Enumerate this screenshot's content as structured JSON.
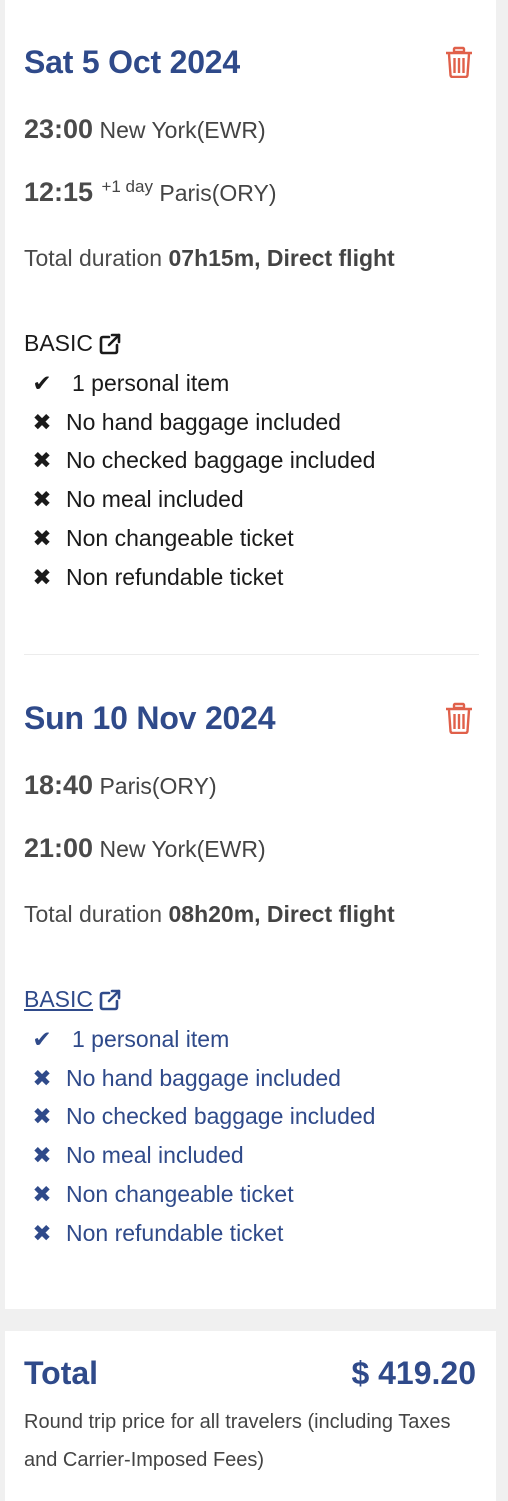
{
  "colors": {
    "accent": "#2f4a8a",
    "trash": "#e0604a",
    "text": "#4a4a4a",
    "background": "#f0f0f0",
    "card": "#ffffff"
  },
  "segments": [
    {
      "date": "Sat 5 Oct 2024",
      "departure": {
        "time": "23:00",
        "place": "New York(EWR)"
      },
      "arrival": {
        "time": "12:15",
        "day_offset": "+1 day",
        "place": "Paris(ORY)"
      },
      "duration_label": "Total duration",
      "duration_value": "07h15m, Direct flight",
      "fare_name": "BASIC",
      "features": [
        {
          "icon": "check-icon",
          "text": "1 personal item"
        },
        {
          "icon": "x-icon",
          "text": "No hand baggage included"
        },
        {
          "icon": "x-icon",
          "text": "No checked baggage included"
        },
        {
          "icon": "x-icon",
          "text": "No meal included"
        },
        {
          "icon": "x-icon",
          "text": "Non changeable ticket"
        },
        {
          "icon": "x-icon",
          "text": "Non refundable ticket"
        }
      ]
    },
    {
      "date": "Sun 10 Nov 2024",
      "departure": {
        "time": "18:40",
        "place": "Paris(ORY)"
      },
      "arrival": {
        "time": "21:00",
        "day_offset": "",
        "place": "New York(EWR)"
      },
      "duration_label": "Total duration",
      "duration_value": "08h20m, Direct flight",
      "fare_name": "BASIC",
      "features": [
        {
          "icon": "check-icon",
          "text": "1 personal item"
        },
        {
          "icon": "x-icon",
          "text": "No hand baggage included"
        },
        {
          "icon": "x-icon",
          "text": "No checked baggage included"
        },
        {
          "icon": "x-icon",
          "text": "No meal included"
        },
        {
          "icon": "x-icon",
          "text": "Non changeable ticket"
        },
        {
          "icon": "x-icon",
          "text": "Non refundable ticket"
        }
      ]
    }
  ],
  "total": {
    "label": "Total",
    "price": "$ 419.20",
    "note": "Round trip price for all travelers (including Taxes and Carrier-Imposed Fees)"
  }
}
